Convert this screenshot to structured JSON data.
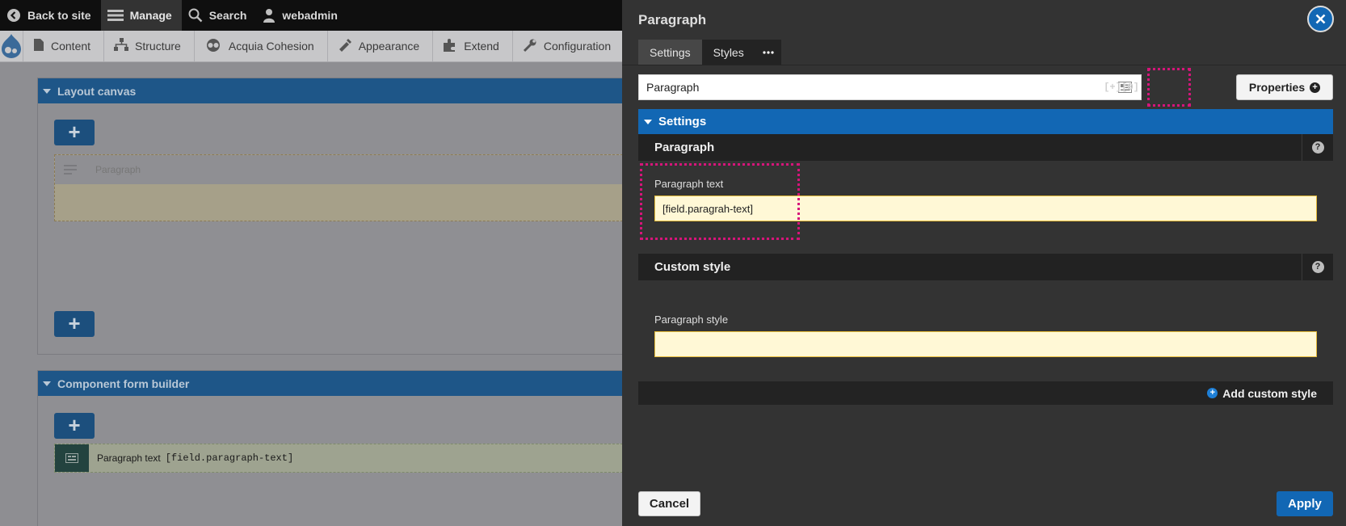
{
  "toolbar": {
    "back_label": "Back to site",
    "manage_label": "Manage",
    "search_label": "Search",
    "user_label": "webadmin"
  },
  "tray": {
    "items": [
      {
        "label": "Content",
        "icon": "content-icon"
      },
      {
        "label": "Structure",
        "icon": "structure-icon"
      },
      {
        "label": "Acquia Cohesion",
        "icon": "cohesion-icon"
      },
      {
        "label": "Appearance",
        "icon": "appearance-icon"
      },
      {
        "label": "Extend",
        "icon": "extend-icon"
      },
      {
        "label": "Configuration",
        "icon": "configuration-icon"
      }
    ]
  },
  "layout_canvas": {
    "title": "Layout canvas",
    "component_label": "Paragraph"
  },
  "form_builder": {
    "title": "Component form builder",
    "field_label": "Paragraph text",
    "field_token": "[field.paragraph-text]"
  },
  "modal": {
    "title": "Paragraph",
    "tabs": [
      "Settings",
      "Styles"
    ],
    "name_value": "Paragraph",
    "variable_btn": "[+]",
    "token_btn": "[ʘ]",
    "properties_label": "Properties",
    "settings_title": "Settings",
    "paragraph_group": {
      "title": "Paragraph",
      "field_label": "Paragraph text",
      "field_value": "[field.paragrah-text]"
    },
    "custom_style_group": {
      "title": "Custom style",
      "field_label": "Paragraph style",
      "field_value": ""
    },
    "add_custom_style_label": "Add custom style",
    "cancel_label": "Cancel",
    "apply_label": "Apply"
  },
  "colors": {
    "accent_blue": "#1267b4",
    "highlight_pink": "#d6157a",
    "input_yellow": "#fff8d6"
  }
}
